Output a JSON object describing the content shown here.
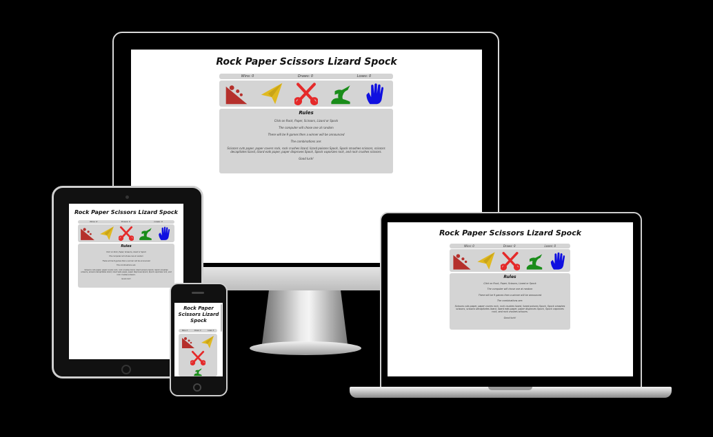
{
  "app": {
    "title": "Rock Paper Scissors Lizard Spock",
    "title_phone": [
      "Rock Paper",
      "Scissors Lizard",
      "Spock"
    ],
    "score": {
      "wins": "Wins: 0",
      "draws": "Draws: 0",
      "losses": "Loses: 0"
    },
    "choices": [
      {
        "name": "rock",
        "icon": "rock-icon",
        "color": "#b5302c"
      },
      {
        "name": "paper",
        "icon": "paper-icon",
        "color": "#e0b920"
      },
      {
        "name": "scissors",
        "icon": "scissors-icon",
        "color": "#e52a2a"
      },
      {
        "name": "lizard",
        "icon": "lizard-icon",
        "color": "#1a8c1a"
      },
      {
        "name": "spock",
        "icon": "spock-icon",
        "color": "#1010e0"
      }
    ],
    "rules": {
      "heading": "Rules",
      "line1": "Click on Rock, Paper, Scissors, Lizard or Spock",
      "line2": "The computer will chose one at random",
      "line3": "There will be 9 games then a winner will be announced",
      "line4": "The combinations are:",
      "line5": "Scissors cuts paper, paper covers rock, rock crushes lizard, lizard poisons Spock, Spock smashes scissors, scissors decapitates lizard, lizard eats paper, paper disproves Spock, Spock vaporizes rock, and rock crushes scissors.",
      "line6": "Good luck!"
    }
  }
}
